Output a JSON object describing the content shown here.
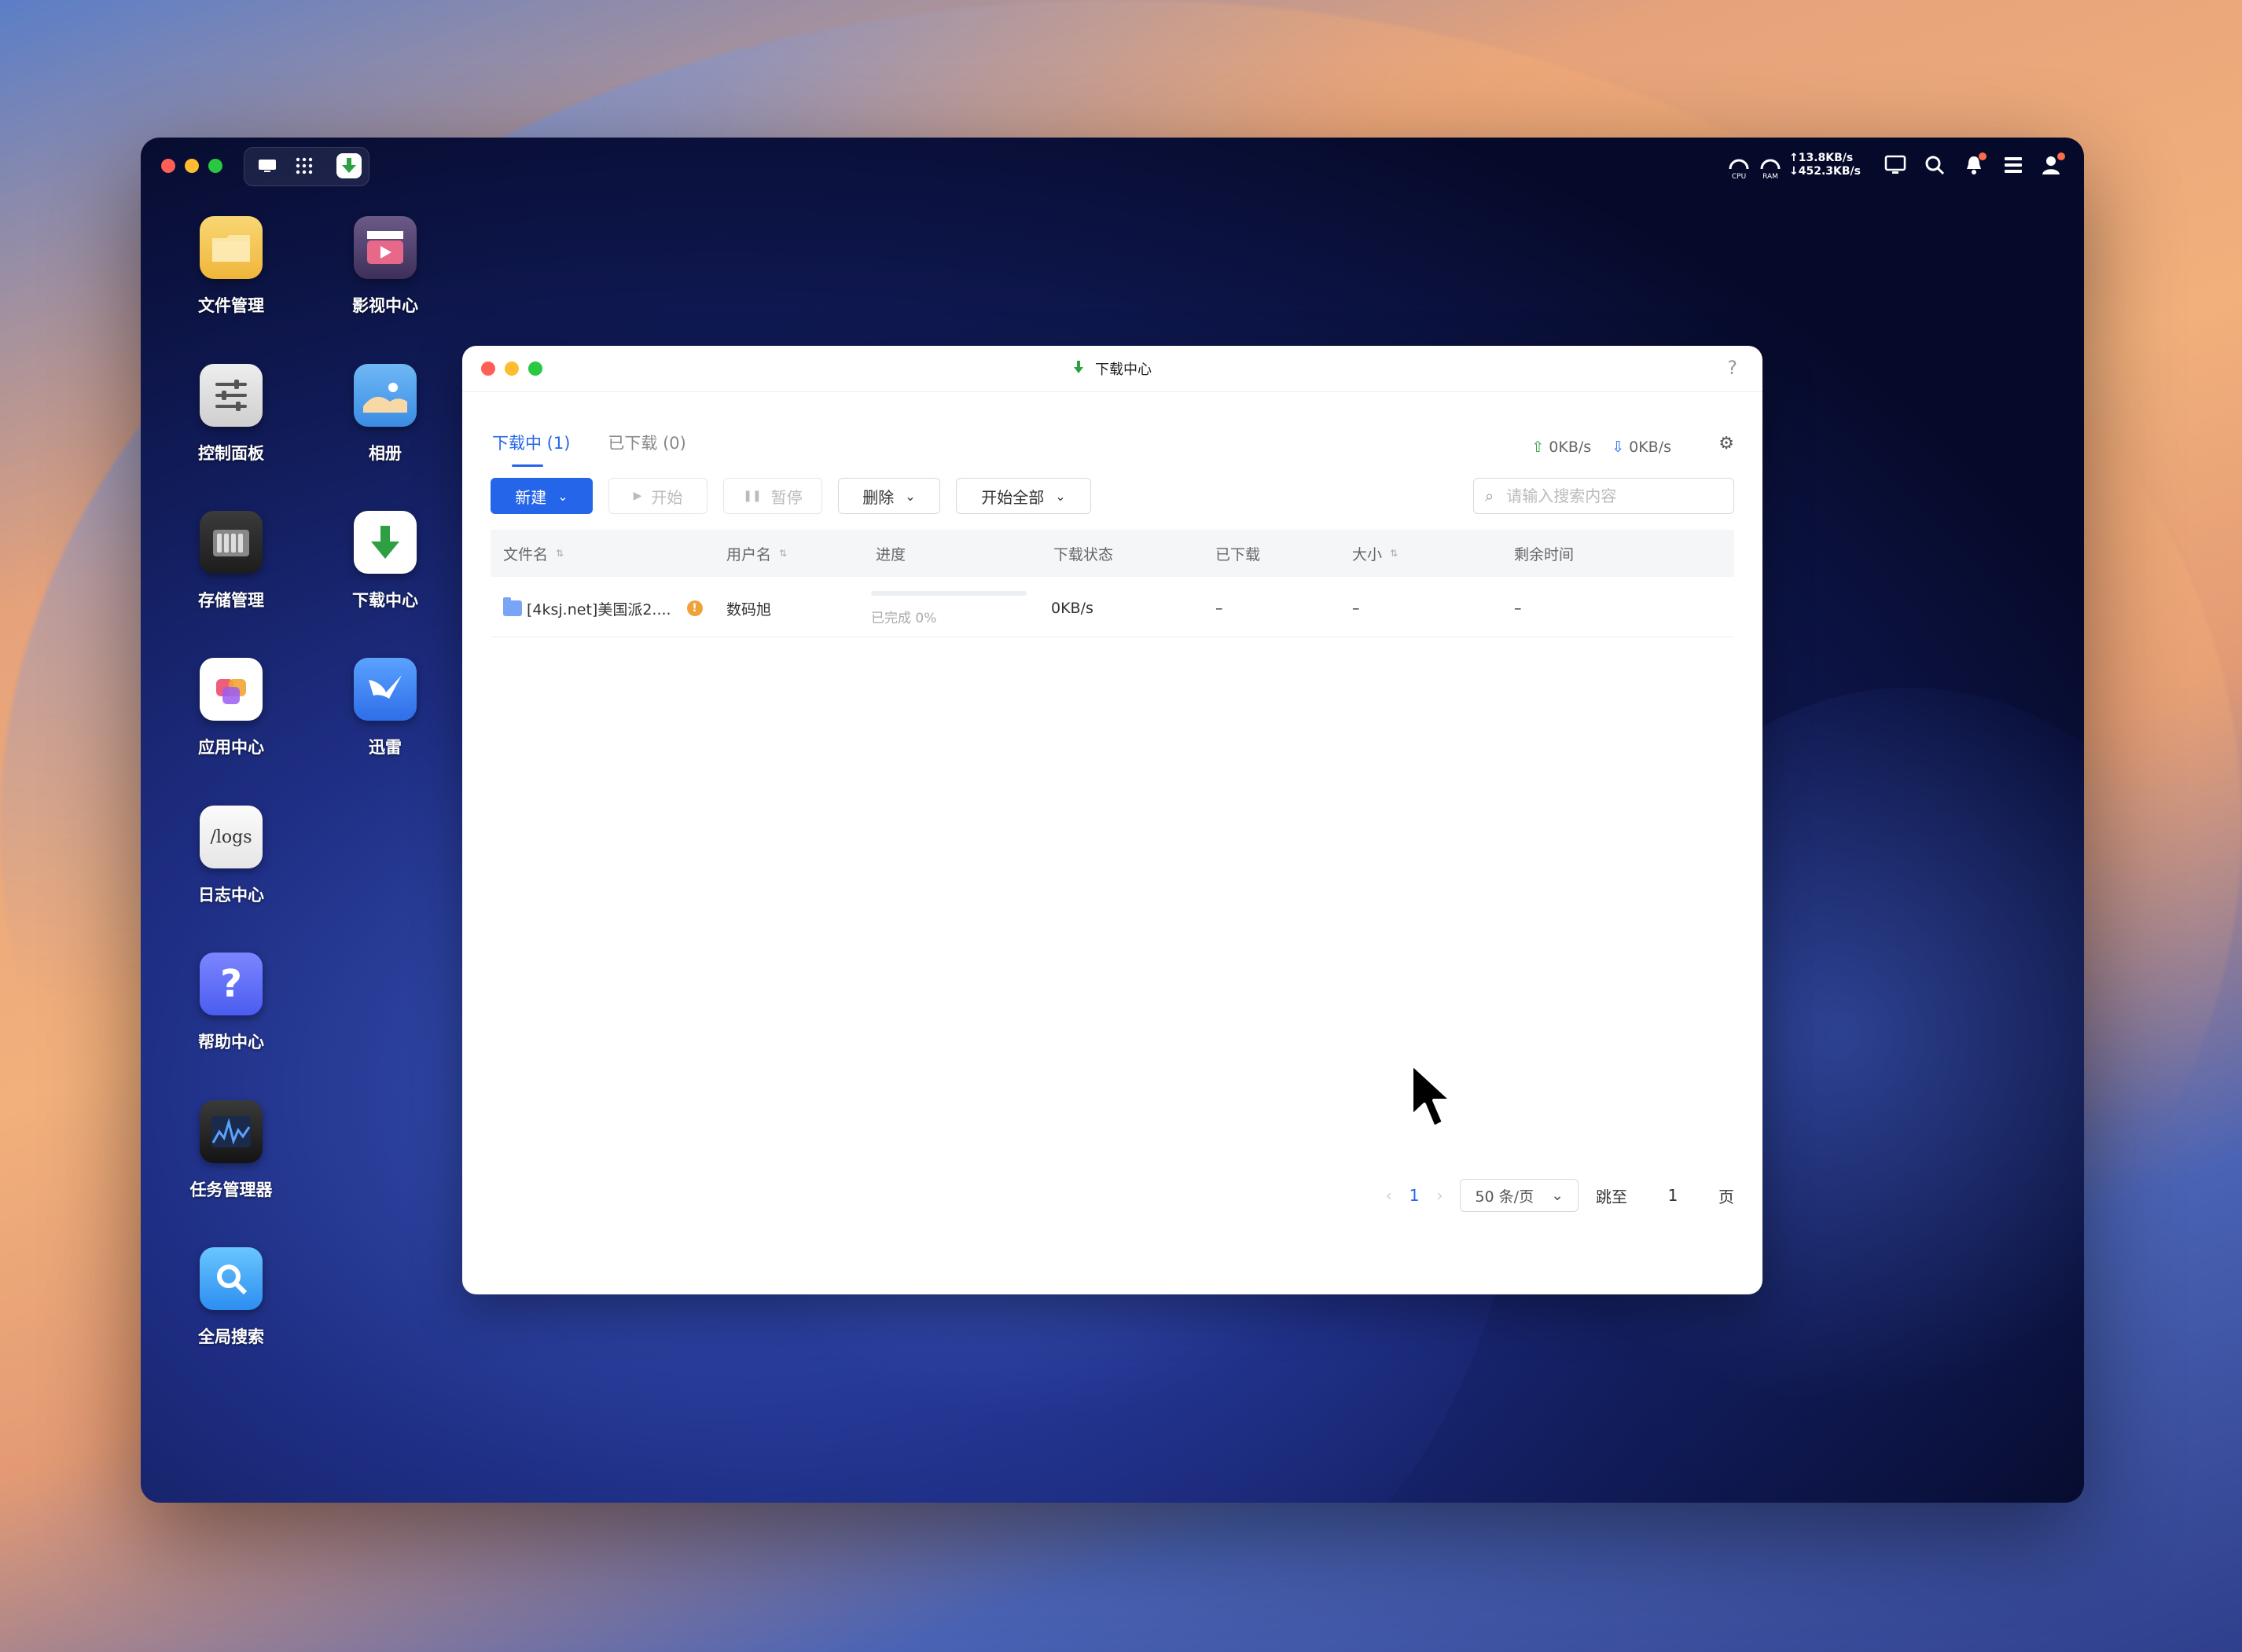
{
  "system": {
    "net_up": "13.8KB/s",
    "net_down": "452.3KB/s",
    "cpu_label": "CPU",
    "ram_label": "RAM"
  },
  "desktop_icons": [
    {
      "label": "文件管理",
      "icon": "folder-icon"
    },
    {
      "label": "影视中心",
      "icon": "clapper-icon"
    },
    {
      "label": "控制面板",
      "icon": "sliders-icon"
    },
    {
      "label": "相册",
      "icon": "photo-icon"
    },
    {
      "label": "存储管理",
      "icon": "storage-icon"
    },
    {
      "label": "下载中心",
      "icon": "download-icon"
    },
    {
      "label": "应用中心",
      "icon": "apps-icon"
    },
    {
      "label": "迅雷",
      "icon": "thunder-icon"
    },
    {
      "label": "日志中心",
      "icon": "logs-icon"
    },
    {
      "label": "帮助中心",
      "icon": "help-icon"
    },
    {
      "label": "任务管理器",
      "icon": "activity-icon"
    },
    {
      "label": "全局搜索",
      "icon": "search-icon"
    }
  ],
  "logs_tile_text": "/logs",
  "app": {
    "title": "下载中心",
    "help": "?",
    "tabs": [
      {
        "label": "下载中心",
        "active": true
      },
      {
        "label": "已下载 (0)",
        "active": false
      }
    ],
    "tab_active_label": "下载中 (1)",
    "upload_speed": "0KB/s",
    "download_speed": "0KB/s",
    "toolbar": {
      "new": "新建",
      "start": "开始",
      "pause": "暂停",
      "delete": "删除",
      "start_all": "开始全部"
    },
    "search_placeholder": "请输入搜索内容",
    "columns": [
      "文件名",
      "用户名",
      "进度",
      "下载状态",
      "已下载",
      "大小",
      "剩余时间"
    ],
    "rows": [
      {
        "filename": "[4ksj.net]美国派2....",
        "user": "数码旭",
        "progress_text": "已完成 0%",
        "progress": 0,
        "status": "0KB/s",
        "downloaded": "–",
        "size": "–",
        "remaining": "–"
      }
    ],
    "pager": {
      "prev": "‹",
      "current": "1",
      "next": "›",
      "page_size": "50 条/页",
      "jump_label": "跳至",
      "jump_value": "1",
      "page_suffix": "页"
    }
  },
  "colors": {
    "accent": "#2465e9",
    "download_green": "#2ea043"
  }
}
